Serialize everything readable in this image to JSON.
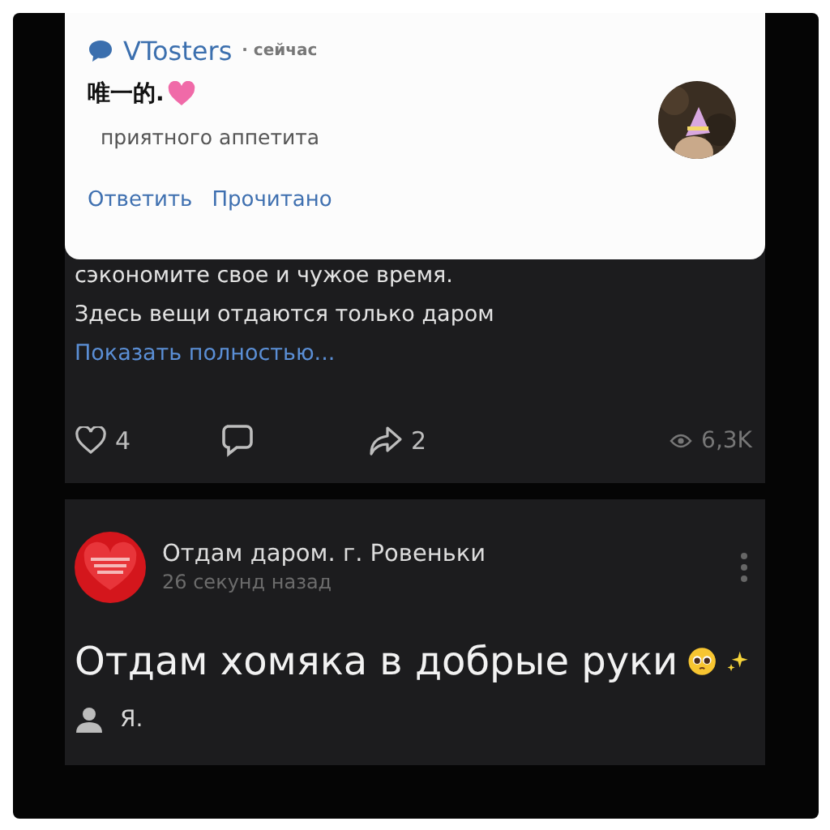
{
  "notification": {
    "app": "VTosters",
    "time": "· сейчас",
    "title": "唯一的.",
    "message": "приятного аппетита",
    "actions": [
      "Ответить",
      "Прочитано"
    ]
  },
  "post_1": {
    "lines": [
      "сэкономите свое и чужое время.",
      "Здесь вещи отдаются только даром"
    ],
    "more_link": "Показать полностью...",
    "likes": "4",
    "shares": "2",
    "views": "6,3K"
  },
  "post_2": {
    "author": "Отдам даром. г. Ровеньки",
    "time": "26 секунд назад",
    "text": "Отдам хомяка в добрые руки",
    "signer": "Я."
  }
}
